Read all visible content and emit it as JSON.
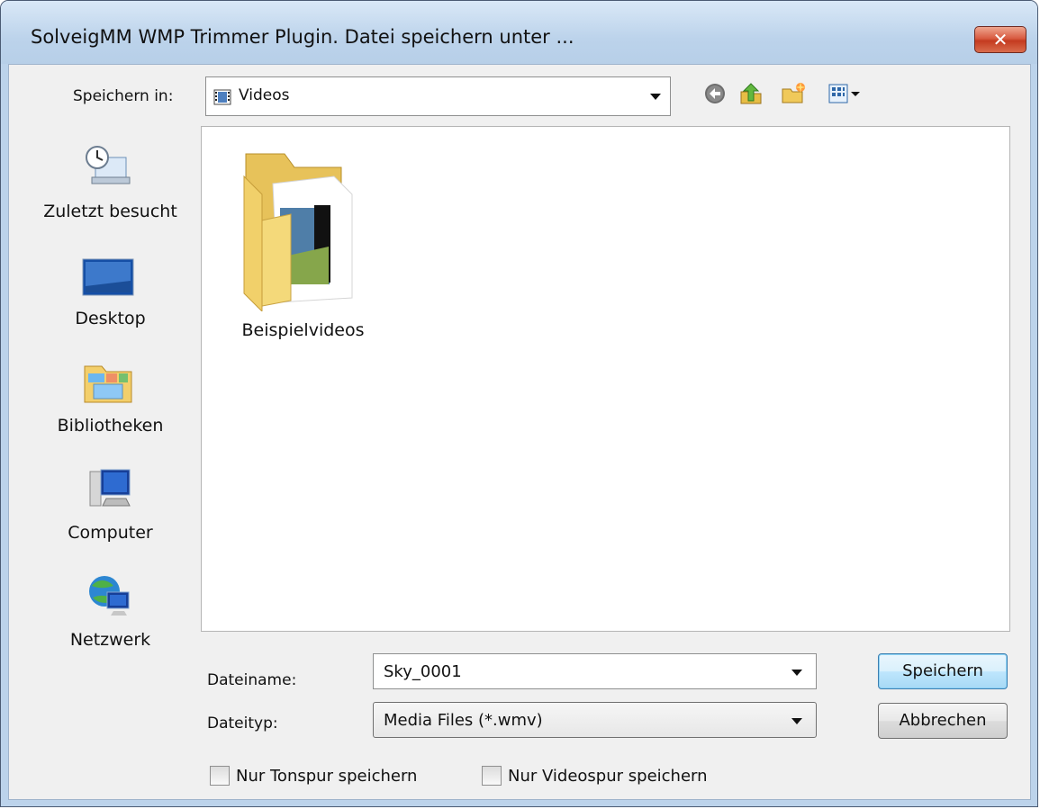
{
  "window": {
    "title": "SolveigMM WMP Trimmer Plugin. Datei speichern unter ...",
    "close_symbol": "✕"
  },
  "location": {
    "label": "Speichern in:",
    "value": "Videos",
    "icon": "videos-library-icon"
  },
  "toolbar": {
    "icons": [
      "back-icon",
      "up-folder-icon",
      "new-folder-icon",
      "view-menu-icon"
    ]
  },
  "places": [
    {
      "label": "Zuletzt besucht",
      "icon": "recent-places-icon"
    },
    {
      "label": "Desktop",
      "icon": "desktop-icon"
    },
    {
      "label": "Bibliotheken",
      "icon": "libraries-icon"
    },
    {
      "label": "Computer",
      "icon": "computer-icon"
    },
    {
      "label": "Netzwerk",
      "icon": "network-icon"
    }
  ],
  "files": [
    {
      "name": "Beispielvideos",
      "icon": "folder-icon"
    }
  ],
  "filename": {
    "label": "Dateiname:",
    "value": "Sky_0001"
  },
  "filetype": {
    "label": "Dateityp:",
    "value": "Media Files (*.wmv)"
  },
  "buttons": {
    "save": "Speichern",
    "cancel": "Abbrechen"
  },
  "options": {
    "audio_only": {
      "label": "Nur Tonspur speichern",
      "checked": false
    },
    "video_only": {
      "label": "Nur Videospur speichern",
      "checked": false
    }
  },
  "colors": {
    "title_bar": "#bcd3eb",
    "close_button": "#d85c42",
    "default_button": "#3c7fb1"
  }
}
